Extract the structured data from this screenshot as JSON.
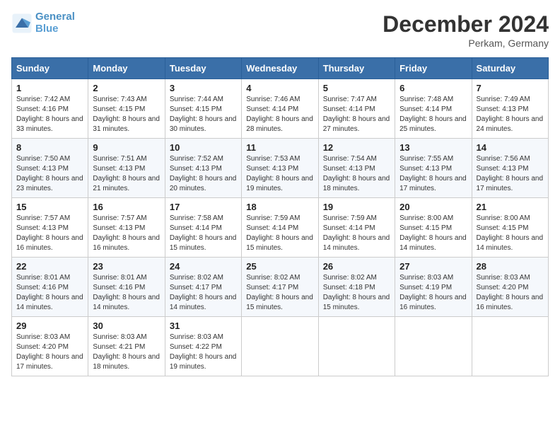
{
  "header": {
    "logo_line1": "General",
    "logo_line2": "Blue",
    "month": "December 2024",
    "location": "Perkam, Germany"
  },
  "weekdays": [
    "Sunday",
    "Monday",
    "Tuesday",
    "Wednesday",
    "Thursday",
    "Friday",
    "Saturday"
  ],
  "weeks": [
    [
      {
        "day": "1",
        "sunrise": "7:42 AM",
        "sunset": "4:16 PM",
        "daylight": "8 hours and 33 minutes."
      },
      {
        "day": "2",
        "sunrise": "7:43 AM",
        "sunset": "4:15 PM",
        "daylight": "8 hours and 31 minutes."
      },
      {
        "day": "3",
        "sunrise": "7:44 AM",
        "sunset": "4:15 PM",
        "daylight": "8 hours and 30 minutes."
      },
      {
        "day": "4",
        "sunrise": "7:46 AM",
        "sunset": "4:14 PM",
        "daylight": "8 hours and 28 minutes."
      },
      {
        "day": "5",
        "sunrise": "7:47 AM",
        "sunset": "4:14 PM",
        "daylight": "8 hours and 27 minutes."
      },
      {
        "day": "6",
        "sunrise": "7:48 AM",
        "sunset": "4:14 PM",
        "daylight": "8 hours and 25 minutes."
      },
      {
        "day": "7",
        "sunrise": "7:49 AM",
        "sunset": "4:13 PM",
        "daylight": "8 hours and 24 minutes."
      }
    ],
    [
      {
        "day": "8",
        "sunrise": "7:50 AM",
        "sunset": "4:13 PM",
        "daylight": "8 hours and 23 minutes."
      },
      {
        "day": "9",
        "sunrise": "7:51 AM",
        "sunset": "4:13 PM",
        "daylight": "8 hours and 21 minutes."
      },
      {
        "day": "10",
        "sunrise": "7:52 AM",
        "sunset": "4:13 PM",
        "daylight": "8 hours and 20 minutes."
      },
      {
        "day": "11",
        "sunrise": "7:53 AM",
        "sunset": "4:13 PM",
        "daylight": "8 hours and 19 minutes."
      },
      {
        "day": "12",
        "sunrise": "7:54 AM",
        "sunset": "4:13 PM",
        "daylight": "8 hours and 18 minutes."
      },
      {
        "day": "13",
        "sunrise": "7:55 AM",
        "sunset": "4:13 PM",
        "daylight": "8 hours and 17 minutes."
      },
      {
        "day": "14",
        "sunrise": "7:56 AM",
        "sunset": "4:13 PM",
        "daylight": "8 hours and 17 minutes."
      }
    ],
    [
      {
        "day": "15",
        "sunrise": "7:57 AM",
        "sunset": "4:13 PM",
        "daylight": "8 hours and 16 minutes."
      },
      {
        "day": "16",
        "sunrise": "7:57 AM",
        "sunset": "4:13 PM",
        "daylight": "8 hours and 16 minutes."
      },
      {
        "day": "17",
        "sunrise": "7:58 AM",
        "sunset": "4:14 PM",
        "daylight": "8 hours and 15 minutes."
      },
      {
        "day": "18",
        "sunrise": "7:59 AM",
        "sunset": "4:14 PM",
        "daylight": "8 hours and 15 minutes."
      },
      {
        "day": "19",
        "sunrise": "7:59 AM",
        "sunset": "4:14 PM",
        "daylight": "8 hours and 14 minutes."
      },
      {
        "day": "20",
        "sunrise": "8:00 AM",
        "sunset": "4:15 PM",
        "daylight": "8 hours and 14 minutes."
      },
      {
        "day": "21",
        "sunrise": "8:00 AM",
        "sunset": "4:15 PM",
        "daylight": "8 hours and 14 minutes."
      }
    ],
    [
      {
        "day": "22",
        "sunrise": "8:01 AM",
        "sunset": "4:16 PM",
        "daylight": "8 hours and 14 minutes."
      },
      {
        "day": "23",
        "sunrise": "8:01 AM",
        "sunset": "4:16 PM",
        "daylight": "8 hours and 14 minutes."
      },
      {
        "day": "24",
        "sunrise": "8:02 AM",
        "sunset": "4:17 PM",
        "daylight": "8 hours and 14 minutes."
      },
      {
        "day": "25",
        "sunrise": "8:02 AM",
        "sunset": "4:17 PM",
        "daylight": "8 hours and 15 minutes."
      },
      {
        "day": "26",
        "sunrise": "8:02 AM",
        "sunset": "4:18 PM",
        "daylight": "8 hours and 15 minutes."
      },
      {
        "day": "27",
        "sunrise": "8:03 AM",
        "sunset": "4:19 PM",
        "daylight": "8 hours and 16 minutes."
      },
      {
        "day": "28",
        "sunrise": "8:03 AM",
        "sunset": "4:20 PM",
        "daylight": "8 hours and 16 minutes."
      }
    ],
    [
      {
        "day": "29",
        "sunrise": "8:03 AM",
        "sunset": "4:20 PM",
        "daylight": "8 hours and 17 minutes."
      },
      {
        "day": "30",
        "sunrise": "8:03 AM",
        "sunset": "4:21 PM",
        "daylight": "8 hours and 18 minutes."
      },
      {
        "day": "31",
        "sunrise": "8:03 AM",
        "sunset": "4:22 PM",
        "daylight": "8 hours and 19 minutes."
      },
      null,
      null,
      null,
      null
    ]
  ]
}
